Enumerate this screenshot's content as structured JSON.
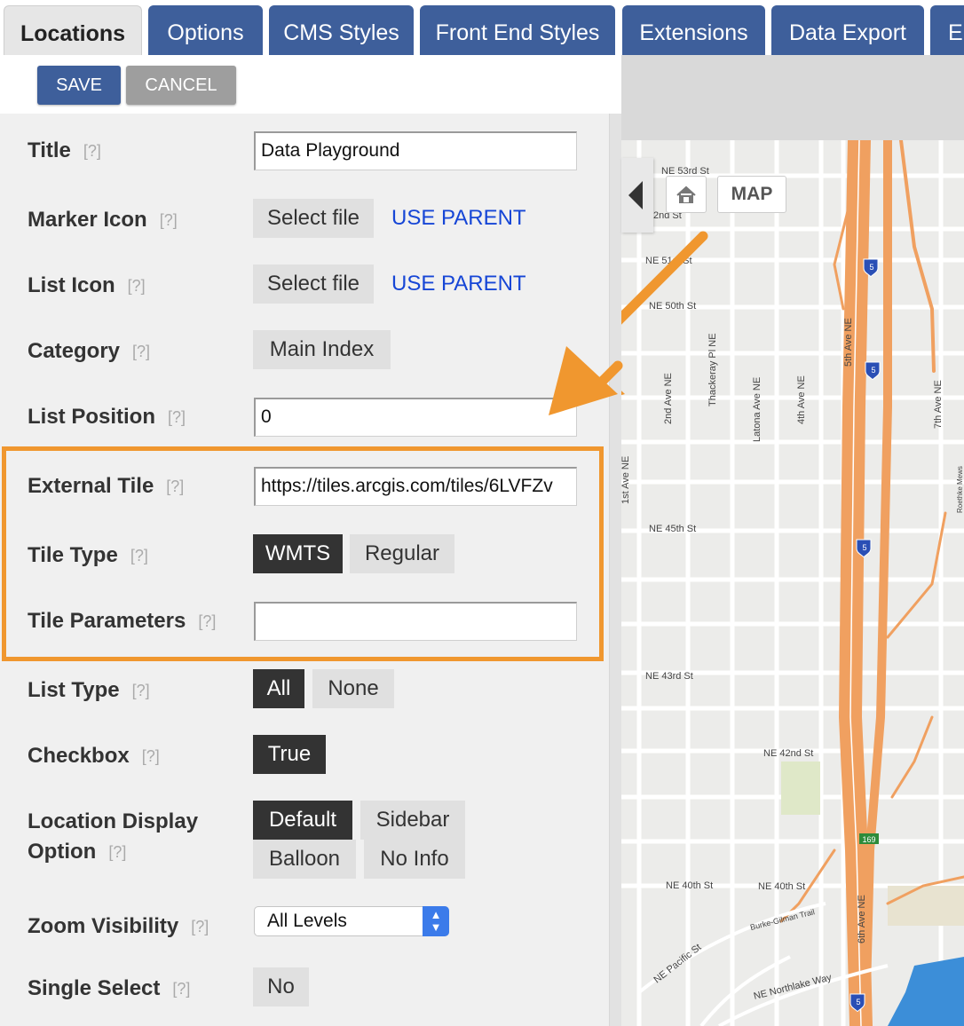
{
  "tabs": [
    "Locations",
    "Options",
    "CMS Styles",
    "Front End Styles",
    "Extensions",
    "Data Export",
    "E"
  ],
  "actions": {
    "save": "SAVE",
    "cancel": "CANCEL"
  },
  "help_marker": "[?]",
  "fields": {
    "title": {
      "label": "Title",
      "value": "Data Playground"
    },
    "marker_icon": {
      "label": "Marker Icon",
      "select": "Select file",
      "link": "USE PARENT"
    },
    "list_icon": {
      "label": "List Icon",
      "select": "Select file",
      "link": "USE PARENT"
    },
    "category": {
      "label": "Category",
      "value": "Main Index"
    },
    "list_position": {
      "label": "List Position",
      "value": "0"
    },
    "external_tile": {
      "label": "External Tile",
      "value": "https://tiles.arcgis.com/tiles/6LVFZv"
    },
    "tile_type": {
      "label": "Tile Type",
      "options": [
        "WMTS",
        "Regular"
      ],
      "selected": "WMTS"
    },
    "tile_parameters": {
      "label": "Tile Parameters",
      "value": ""
    },
    "list_type": {
      "label": "List Type",
      "options": [
        "All",
        "None"
      ],
      "selected": "All"
    },
    "checkbox": {
      "label": "Checkbox",
      "options": [
        "True"
      ],
      "selected": "True"
    },
    "location_display": {
      "label_line1": "Location Display",
      "label_line2": "Option",
      "options": [
        "Default",
        "Sidebar",
        "Balloon",
        "No Info"
      ],
      "selected": "Default"
    },
    "zoom_visibility": {
      "label": "Zoom Visibility",
      "value": "All Levels"
    },
    "single_select": {
      "label": "Single Select",
      "options": [
        "No"
      ],
      "selected": ""
    }
  },
  "map": {
    "map_button": "MAP",
    "street_labels": [
      "NE 53rd St",
      "2nd St",
      "NE 51st St",
      "NE 50th St",
      "NE 45th St",
      "NE 43rd St",
      "NE 42nd St",
      "NE 40th St",
      "NE 40th St",
      "NE Pacific St",
      "Burke-Gilman Trail",
      "NE Northlake Way",
      "Latona Ave NE",
      "Thackeray Pl NE",
      "2nd Ave NE",
      "4th Ave NE",
      "5th Ave NE",
      "7th Ave NE",
      "1st Ave NE",
      "6th Ave NE",
      "Roethke Mews"
    ],
    "shields": [
      "5",
      "169"
    ]
  },
  "colors": {
    "tab_blue": "#3e5f9b",
    "highlight_orange": "#f0972f",
    "link_blue": "#1646d6",
    "selected_dark": "#333333"
  }
}
